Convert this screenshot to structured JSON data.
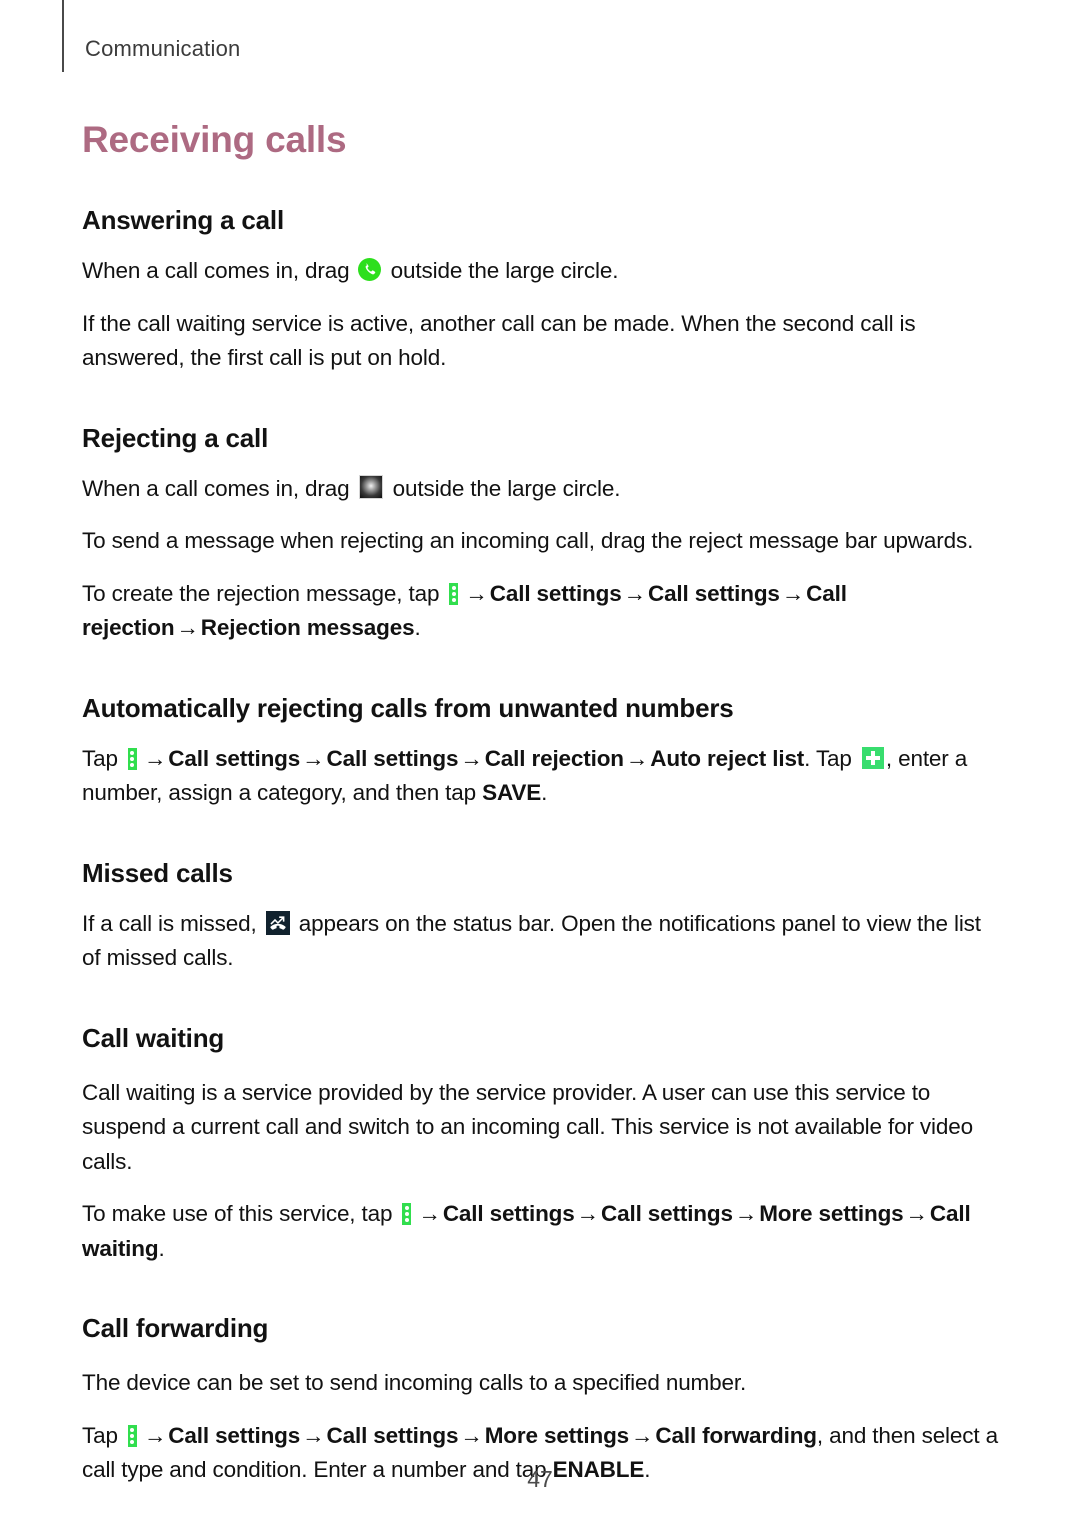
{
  "header": {
    "chapter_label": "Communication"
  },
  "page_title": "Receiving calls",
  "colors": {
    "title": "#ad6a82",
    "body": "#121212",
    "header": "#3b3b3b",
    "icon_answer_green": "#2ddf1d",
    "icon_menu_green": "#31de4e",
    "icon_plus_green": "#38dd6e",
    "icon_dark": "#11222e"
  },
  "sections": [
    {
      "heading": "Answering a call",
      "paragraphs": [
        {
          "id": "answering-p1",
          "parts": [
            {
              "t": "text",
              "v": "When a call comes in, drag "
            },
            {
              "t": "icon",
              "v": "answer-call-icon"
            },
            {
              "t": "text",
              "v": " outside the large circle."
            }
          ],
          "plain": "When a call comes in, drag [answer icon] outside the large circle."
        },
        {
          "id": "answering-p2",
          "parts": [
            {
              "t": "text",
              "v": "If the call waiting service is active, another call can be made. When the second call is answered, the first call is put on hold."
            }
          ],
          "plain": "If the call waiting service is active, another call can be made. When the second call is answered, the first call is put on hold."
        }
      ]
    },
    {
      "heading": "Rejecting a call",
      "paragraphs": [
        {
          "id": "rejecting-p1",
          "plain": "When a call comes in, drag [reject icon] outside the large circle."
        },
        {
          "id": "rejecting-p2",
          "plain": "To send a message when rejecting an incoming call, drag the reject message bar upwards."
        },
        {
          "id": "rejecting-p3",
          "plain": "To create the rejection message, tap [menu icon] → Call settings → Call settings → Call rejection → Rejection messages."
        }
      ]
    },
    {
      "heading": "Automatically rejecting calls from unwanted numbers",
      "paragraphs": [
        {
          "id": "autoreject-p1",
          "plain": "Tap [menu icon] → Call settings → Call settings → Call rejection → Auto reject list. Tap [plus icon], enter a number, assign a category, and then tap SAVE."
        }
      ]
    },
    {
      "heading": "Missed calls",
      "paragraphs": [
        {
          "id": "missed-p1",
          "plain": "If a call is missed, [missed call icon] appears on the status bar. Open the notifications panel to view the list of missed calls."
        }
      ]
    },
    {
      "heading": "Call waiting",
      "paragraphs": [
        {
          "id": "callwaiting-p1",
          "plain": "Call waiting is a service provided by the service provider. A user can use this service to suspend a current call and switch to an incoming call. This service is not available for video calls."
        },
        {
          "id": "callwaiting-p2",
          "plain": "To make use of this service, tap [menu icon] → Call settings → Call settings → More settings → Call waiting."
        }
      ]
    },
    {
      "heading": "Call forwarding",
      "paragraphs": [
        {
          "id": "callforwarding-p1",
          "plain": "The device can be set to send incoming calls to a specified number."
        },
        {
          "id": "callforwarding-p2",
          "plain": "Tap [menu icon] → Call settings → Call settings → More settings → Call forwarding, and then select a call type and condition. Enter a number and tap ENABLE."
        }
      ]
    }
  ],
  "text": {
    "answering_heading": "Answering a call",
    "answering_p1_a": "When a call comes in, drag ",
    "answering_p1_b": " outside the large circle.",
    "answering_p2": "If the call waiting service is active, another call can be made. When the second call is answered, the first call is put on hold.",
    "rejecting_heading": "Rejecting a call",
    "rejecting_p1_a": "When a call comes in, drag ",
    "rejecting_p1_b": " outside the large circle.",
    "rejecting_p2": "To send a message when rejecting an incoming call, drag the reject message bar upwards.",
    "rejecting_p3_a": "To create the rejection message, tap ",
    "rejecting_p3_path1": "Call settings",
    "rejecting_p3_path2": "Call settings",
    "rejecting_p3_path3": "Call rejection",
    "rejecting_p3_path4": "Rejection messages",
    "rejecting_p3_end": ".",
    "autoreject_heading": "Automatically rejecting calls from unwanted numbers",
    "autoreject_p1_a": "Tap ",
    "autoreject_p1_path1": "Call settings",
    "autoreject_p1_path2": "Call settings",
    "autoreject_p1_path3": "Call rejection",
    "autoreject_p1_path4": "Auto reject list",
    "autoreject_p1_b": ". Tap ",
    "autoreject_p1_c": ", enter a number, assign a category, and then tap ",
    "autoreject_p1_save": "SAVE",
    "autoreject_p1_end": ".",
    "missed_heading": "Missed calls",
    "missed_p1_a": "If a call is missed, ",
    "missed_p1_b": " appears on the status bar. Open the notifications panel to view the list of missed calls.",
    "callwaiting_heading": "Call waiting",
    "callwaiting_p1": "Call waiting is a service provided by the service provider. A user can use this service to suspend a current call and switch to an incoming call. This service is not available for video calls.",
    "callwaiting_p2_a": "To make use of this service, tap ",
    "callwaiting_p2_path1": "Call settings",
    "callwaiting_p2_path2": "Call settings",
    "callwaiting_p2_path3": "More settings",
    "callwaiting_p2_path4": "Call waiting",
    "callwaiting_p2_end": ".",
    "callforwarding_heading": "Call forwarding",
    "callforwarding_p1": "The device can be set to send incoming calls to a specified number.",
    "callforwarding_p2_a": "Tap ",
    "callforwarding_p2_path1": "Call settings",
    "callforwarding_p2_path2": "Call settings",
    "callforwarding_p2_path3": "More settings",
    "callforwarding_p2_path4": "Call forwarding",
    "callforwarding_p2_b": ", and then select a call type and condition. Enter a number and tap ",
    "callforwarding_p2_enable": "ENABLE",
    "callforwarding_p2_end": ".",
    "arrow": "→"
  },
  "footer": {
    "page_number": "47"
  }
}
